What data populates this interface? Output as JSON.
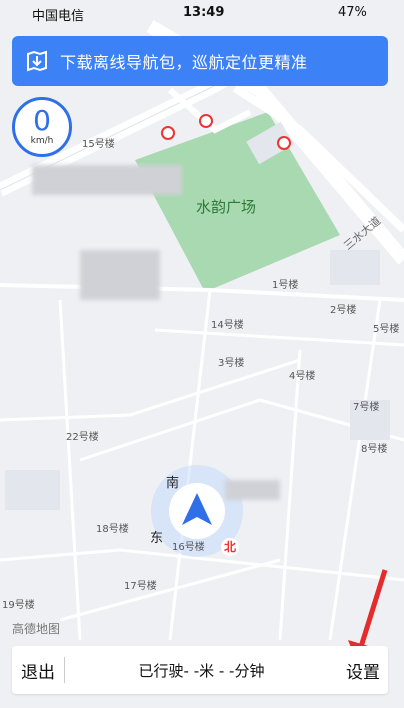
{
  "status_bar": {
    "carrier": "中国电信",
    "time": "13:49",
    "battery": "47%"
  },
  "banner": {
    "text": "下载离线导航包，巡航定位更精准",
    "icon": "download-map-icon"
  },
  "speed": {
    "value": "0",
    "unit": "km/h"
  },
  "map": {
    "plaza": "水韵广场",
    "road": "三水大道",
    "buildings": [
      "15号楼",
      "1号楼",
      "2号楼",
      "14号楼",
      "5号楼",
      "3号楼",
      "4号楼",
      "7号楼",
      "22号楼",
      "8号楼",
      "18号楼",
      "16号楼",
      "17号楼",
      "19号楼"
    ],
    "compass": {
      "south": "南",
      "east": "东",
      "north": "北"
    },
    "brand": "高德地图"
  },
  "bottom_bar": {
    "exit_label": "退出",
    "info": "已行驶- -米  - -分钟",
    "settings_label": "设置"
  },
  "colors": {
    "accent": "#3c82f6",
    "park": "#a8d9b0",
    "arrow": "#e52b2b"
  }
}
